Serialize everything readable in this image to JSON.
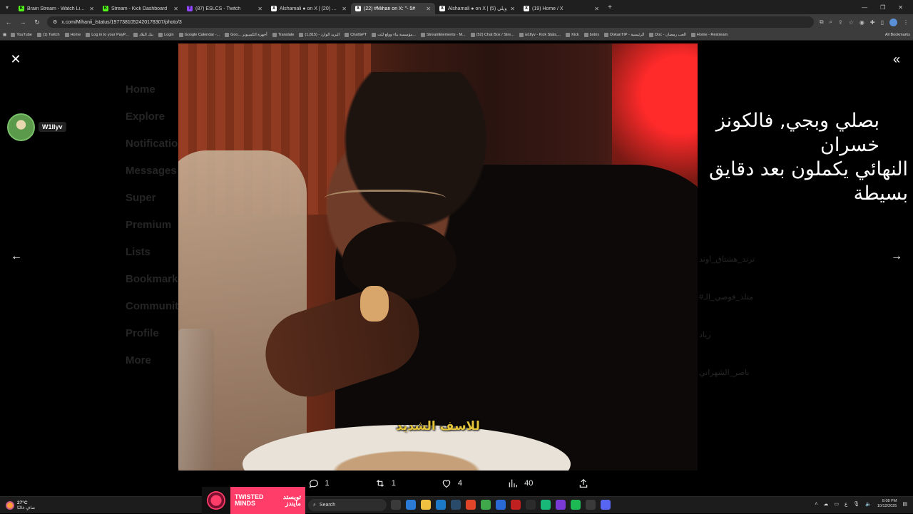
{
  "browser": {
    "tabs": [
      {
        "title": "Brain Stream - Watch Live on Ki",
        "favicon_color": "#53fc18",
        "favicon_glyph": "K",
        "active": false
      },
      {
        "title": "Stream - Kick Dashboard",
        "favicon_color": "#53fc18",
        "favicon_glyph": "K",
        "active": false
      },
      {
        "title": "(87) ESLCS - Twitch",
        "favicon_color": "#9146ff",
        "favicon_glyph": "T",
        "active": false
      },
      {
        "title": "Alshamali ● on X | ويلي (20)",
        "favicon_color": "#ffffff",
        "favicon_glyph": "X",
        "active": false
      },
      {
        "title": "(22) #Mihan on X: \"- 5#",
        "favicon_color": "#ffffff",
        "favicon_glyph": "X",
        "active": true
      },
      {
        "title": "Alshamali ● on X | ويلي (5)",
        "favicon_color": "#ffffff",
        "favicon_glyph": "X",
        "active": false
      },
      {
        "title": "(19) Home / X",
        "favicon_color": "#ffffff",
        "favicon_glyph": "X",
        "active": false
      }
    ],
    "url": "x.com/Mihanii_/status/1977381052420178307/photo/3",
    "bookmarks": [
      "YouTube",
      "(1) Twitch",
      "Home",
      "Log in to your PayP...",
      "بنك البلاد",
      "Login",
      "Google Calendar -...",
      "Goo... أجهزة الكمبيوتر",
      "Translate",
      "البريد الوارد - (1,815)",
      "ChatGPT",
      "مؤسسة بناء وولع للث...",
      "StreamElements - M...",
      "(52) Chat Box / Stre...",
      "w1llyv - Kick Stats,...",
      "Kick",
      "botrix",
      "DokanTIP - الرئيسية",
      "Doc - العب رمضان",
      "Home - Restream"
    ],
    "all_bookmarks": "All Bookmarks"
  },
  "viewer": {
    "overlay_user": "W1llyv",
    "overlay_text_line1": "بصلي وبجي, فالكونز خسران",
    "overlay_text_line2": "النهائي يكملون بعد دقايق بسيطة",
    "caption": "للاسف الشديد",
    "actions": {
      "replies": "1",
      "reposts": "1",
      "likes": "4",
      "views": "40"
    }
  },
  "background_ghost": {
    "nav": [
      "Home",
      "Explore",
      "Notifications",
      "Messages",
      "Super",
      "Premium",
      "Lists",
      "Bookmarks",
      "Communities",
      "Profile",
      "More"
    ],
    "side": [
      "ترند_هشتاق_اوند",
      "#متلذ_فوصي_الـ",
      "رياد",
      "ناصر_الشهراني"
    ]
  },
  "taskbar": {
    "weather_temp": "27°C",
    "weather_desc": "صافٍ غالبًا",
    "promo_en": "TWISTED MINDS",
    "promo_ar": "تويستد مايندز",
    "search_placeholder": "Search",
    "time": "8:08 PM",
    "date": "10/12/2025",
    "lang": "ع"
  },
  "colors": {
    "accent_pink": "#ff3d68",
    "caption_yellow": "#e3c33a",
    "kick_green": "#53fc18",
    "twitch_purple": "#9146ff"
  }
}
